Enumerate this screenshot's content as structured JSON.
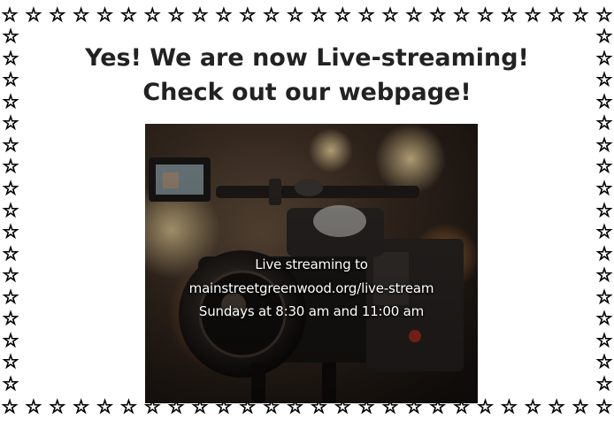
{
  "border": {
    "star_glyph": "☆",
    "star_fill": "#f5ee00",
    "star_outline": "#000000"
  },
  "heading": {
    "line1": "Yes! We are now Live-streaming!",
    "line2": "Check out our webpage!"
  },
  "photo": {
    "subject": "camera-photo",
    "caption": {
      "line1": "Live streaming to",
      "line2": "mainstreetgreenwood.org/live-stream",
      "line3": "Sundays at 8:30 am and 11:00 am"
    }
  }
}
